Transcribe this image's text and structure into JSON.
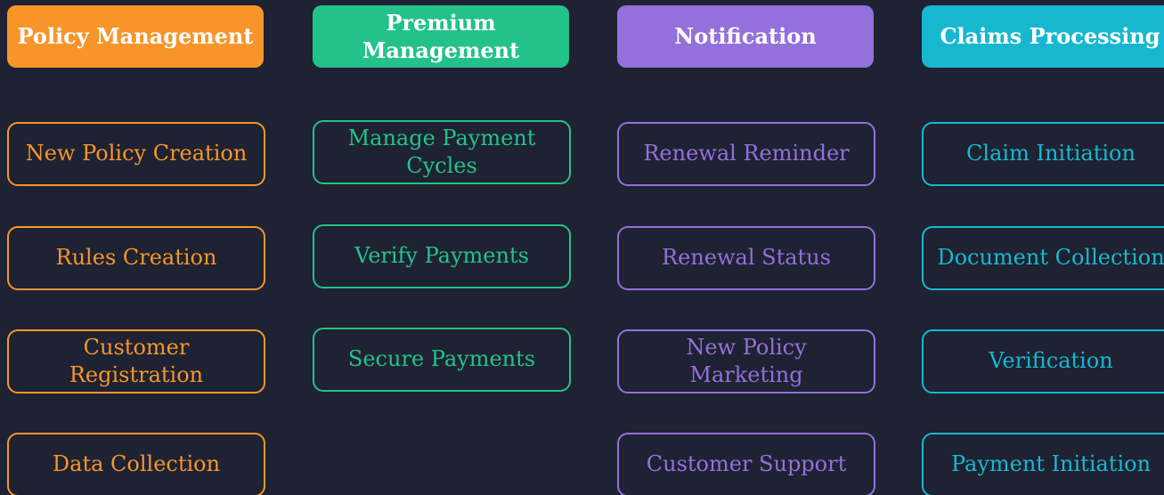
{
  "columns": [
    {
      "title": "Policy Management",
      "color": "#f7952b",
      "items": [
        "New Policy Creation",
        "Rules Creation",
        "Customer Registration",
        "Data Collection"
      ]
    },
    {
      "title": "Premium Management",
      "color": "#23c28b",
      "items": [
        "Manage Payment Cycles",
        "Verify Payments",
        "Secure Payments"
      ]
    },
    {
      "title": "Notification",
      "color": "#9370db",
      "items": [
        "Renewal Reminder",
        "Renewal Status",
        "New Policy Marketing",
        "Customer Support"
      ]
    },
    {
      "title": "Claims Processing",
      "color": "#17b8cf",
      "items": [
        "Claim Initiation",
        "Document Collection",
        "Verification",
        "Payment Initiation"
      ]
    }
  ]
}
